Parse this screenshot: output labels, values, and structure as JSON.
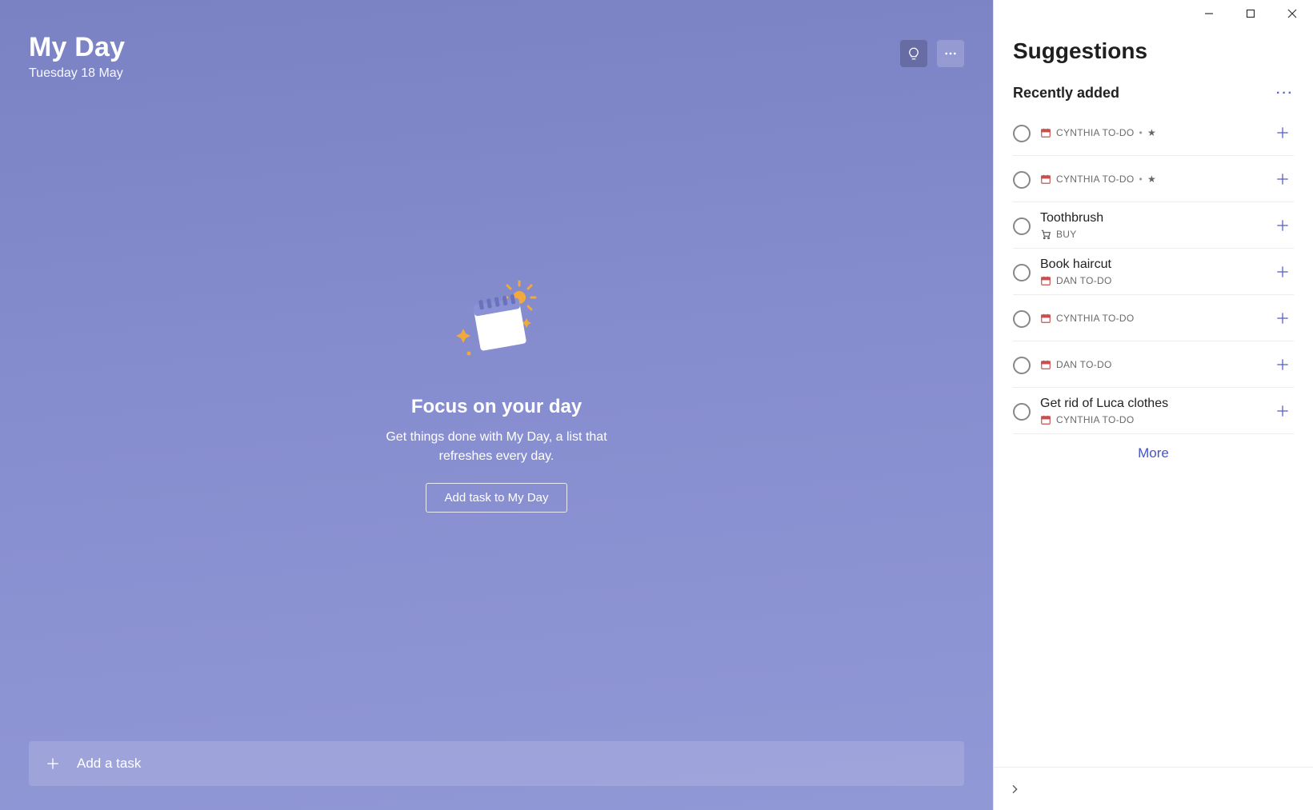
{
  "main": {
    "title": "My Day",
    "date": "Tuesday 18 May",
    "empty": {
      "heading": "Focus on your day",
      "sub": "Get things done with My Day, a list that refreshes every day.",
      "button": "Add task to My Day"
    },
    "add_bar_placeholder": "Add a task"
  },
  "side": {
    "title": "Suggestions",
    "section": "Recently added",
    "more": "More",
    "items": [
      {
        "title": "",
        "list": "CYNTHIA TO-DO",
        "list_icon": "calendar",
        "starred": true
      },
      {
        "title": "",
        "list": "CYNTHIA TO-DO",
        "list_icon": "calendar",
        "starred": true
      },
      {
        "title": "Toothbrush",
        "list": "BUY",
        "list_icon": "cart",
        "starred": false
      },
      {
        "title": "Book haircut",
        "list": "DAN TO-DO",
        "list_icon": "calendar",
        "starred": false
      },
      {
        "title": "",
        "list": "CYNTHIA TO-DO",
        "list_icon": "calendar",
        "starred": false
      },
      {
        "title": "",
        "list": "DAN TO-DO",
        "list_icon": "calendar",
        "starred": false
      },
      {
        "title": "Get rid of Luca clothes",
        "list": "CYNTHIA TO-DO",
        "list_icon": "calendar",
        "starred": false
      }
    ]
  },
  "colors": {
    "accent": "#5864c9"
  }
}
